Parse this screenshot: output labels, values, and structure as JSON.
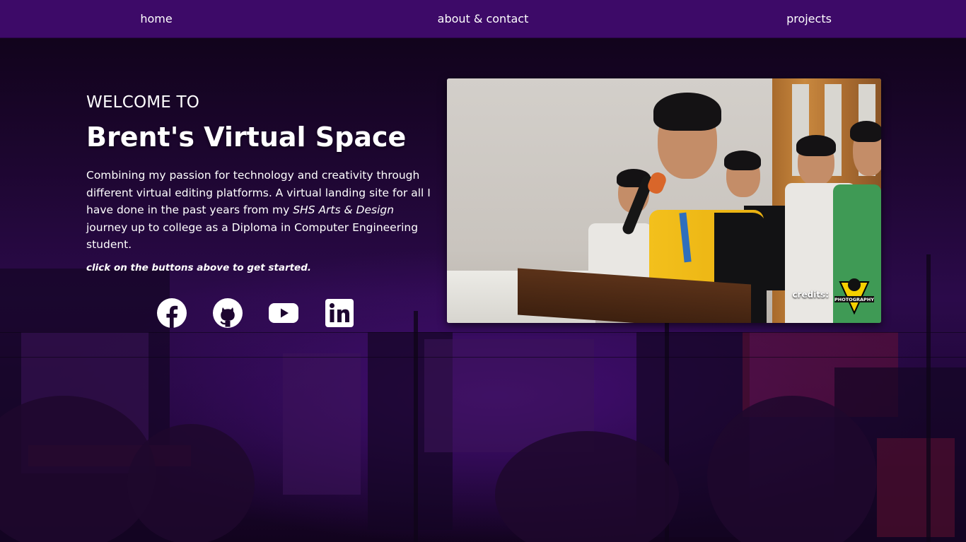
{
  "nav": {
    "items": [
      {
        "label": "home"
      },
      {
        "label": "about & contact"
      },
      {
        "label": "projects"
      }
    ]
  },
  "hero": {
    "welcome": "WELCOME TO",
    "title": "Brent's Virtual Space",
    "description_part1": "Combining my passion for technology and creativity through different virtual editing platforms. A virtual landing site for all I have done in the past years from my ",
    "description_emphasis": "SHS Arts & Design",
    "description_part2": " journey up to college as a Diploma in Computer Engineering student.",
    "hint": "click on the buttons above to get started."
  },
  "socials": [
    {
      "icon": "facebook-icon"
    },
    {
      "icon": "github-icon"
    },
    {
      "icon": "youtube-icon"
    },
    {
      "icon": "linkedin-icon"
    }
  ],
  "photo": {
    "credits_label": "credits:",
    "credits_logo_text": "PHOTOGRAPHY"
  },
  "colors": {
    "nav_background": "#3d0a68",
    "text": "#ffffff",
    "background": "#1d0630"
  }
}
